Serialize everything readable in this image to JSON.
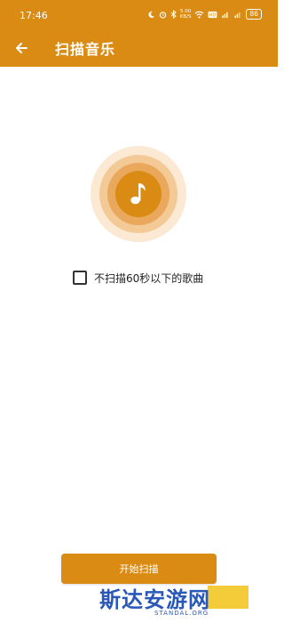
{
  "status_bar": {
    "time": "17:46",
    "network_speed_value": "5.00",
    "network_speed_unit": "KB/S",
    "battery": "86"
  },
  "app_bar": {
    "title": "扫描音乐",
    "back_icon": "arrow-left-icon"
  },
  "colors": {
    "accent": "#d98b14",
    "ring_outer": "#fbe9d4",
    "ring_middle": "#f3c995",
    "ring_inner": "#e9a85c",
    "watermark_blue": "#2a58b8",
    "watermark_yellow": "#f4cc3a"
  },
  "scan_visual": {
    "icon": "music-note-icon"
  },
  "option": {
    "label": "不扫描60秒以下的歌曲",
    "checked": false
  },
  "action": {
    "start_label": "开始扫描"
  },
  "watermark": {
    "text": "斯达安游网",
    "subtext": "STANDAL.ORG"
  }
}
